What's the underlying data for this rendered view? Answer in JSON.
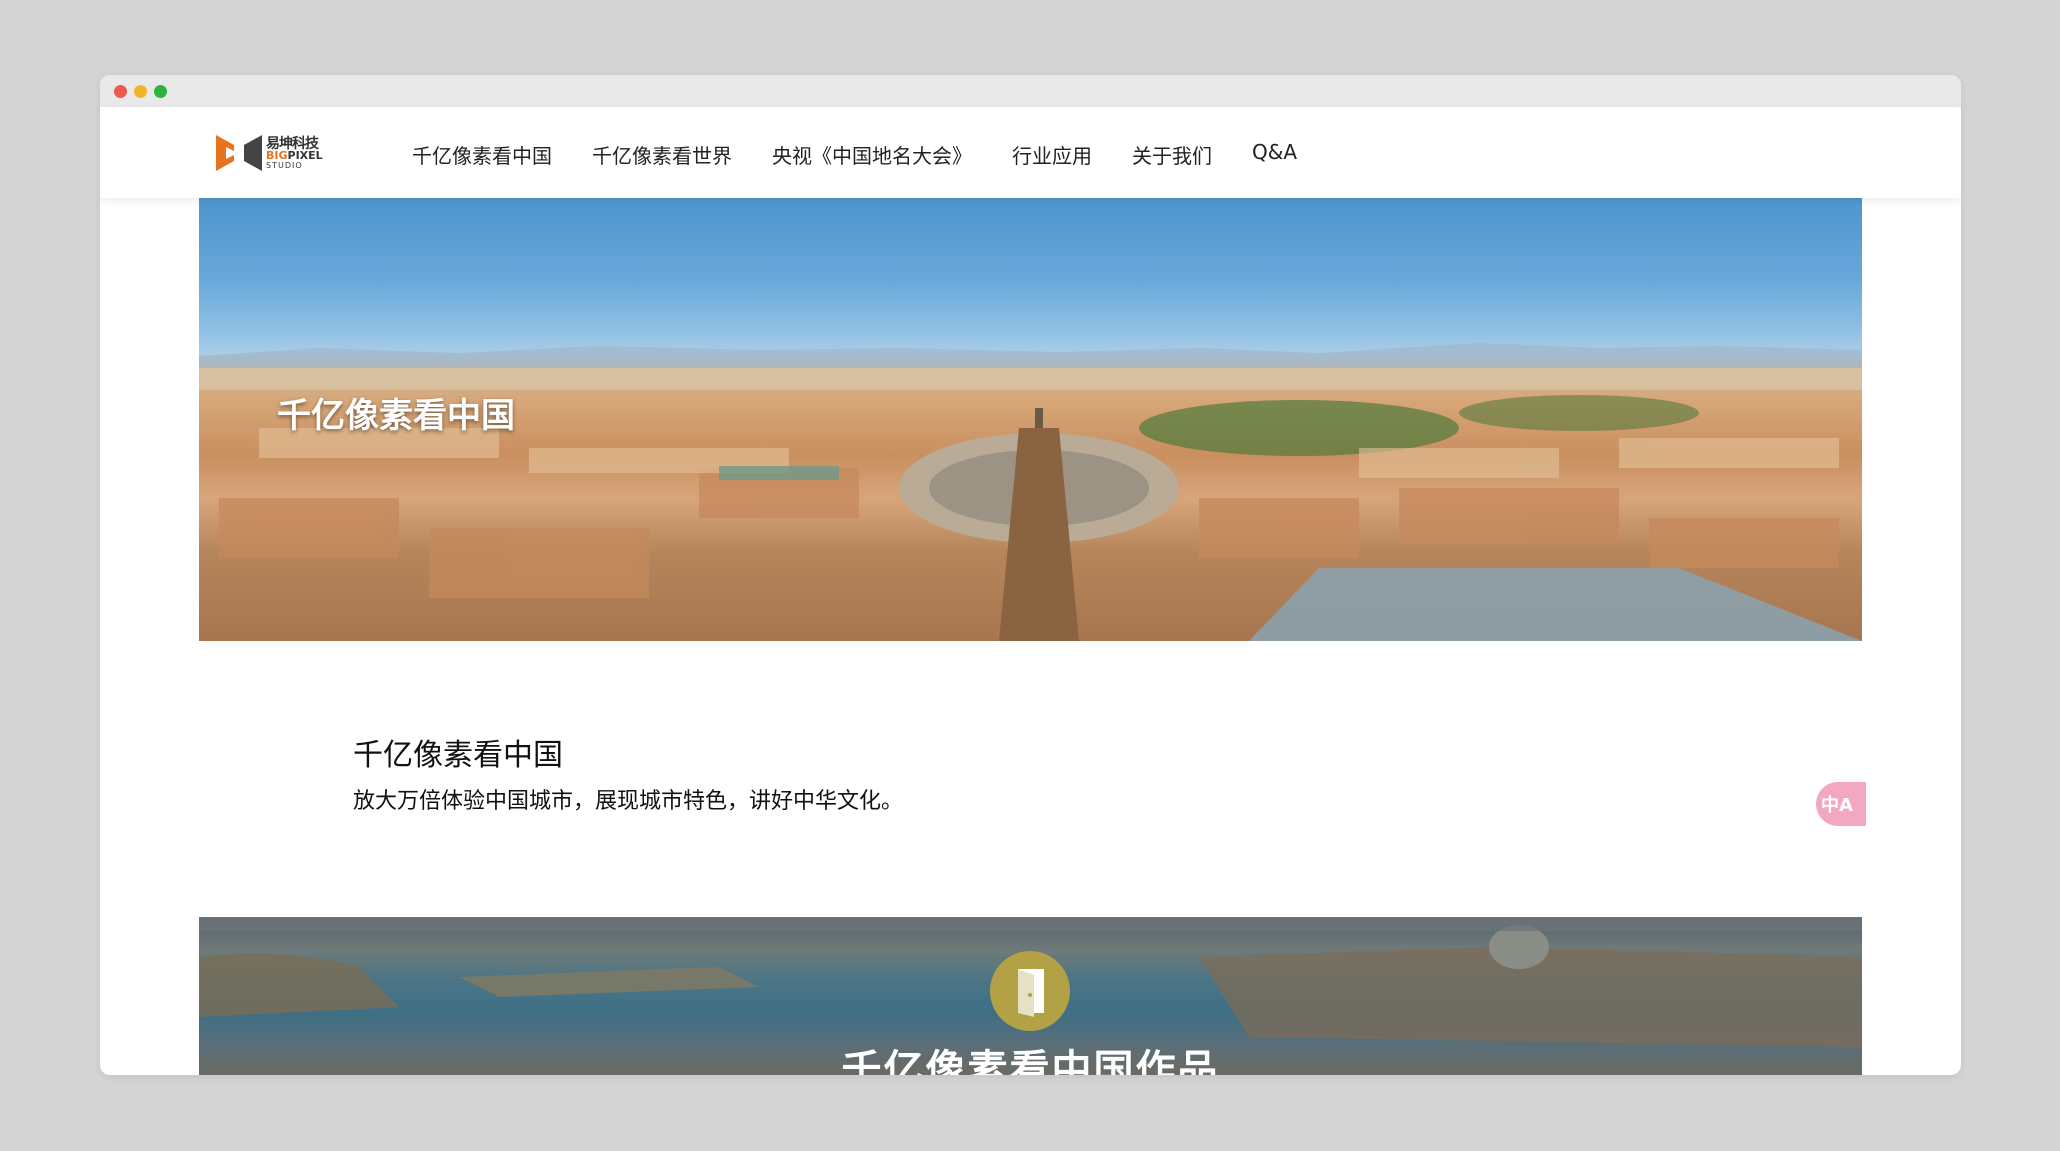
{
  "window": {
    "title": ""
  },
  "brand": {
    "logo_cn": "易坤科技",
    "logo_en_accent": "BIG",
    "logo_en_rest": "PIXEL",
    "logo_en2": "STUDIO",
    "accent_color": "#e8731e"
  },
  "nav": {
    "items": [
      {
        "label": "千亿像素看中国"
      },
      {
        "label": "千亿像素看世界"
      },
      {
        "label": "央视《中国地名大会》"
      },
      {
        "label": "行业应用"
      },
      {
        "label": "关于我们"
      },
      {
        "label": "Q&A"
      }
    ]
  },
  "hero": {
    "title": "千亿像素看中国"
  },
  "section": {
    "title": "千亿像素看中国",
    "description": "放大万倍体验中国城市，展现城市特色，讲好中华文化。"
  },
  "translate": {
    "label": "中A",
    "color": "#f4a7c3"
  },
  "banner2": {
    "title": "千亿像素看中国作品",
    "icon": "door-icon"
  }
}
